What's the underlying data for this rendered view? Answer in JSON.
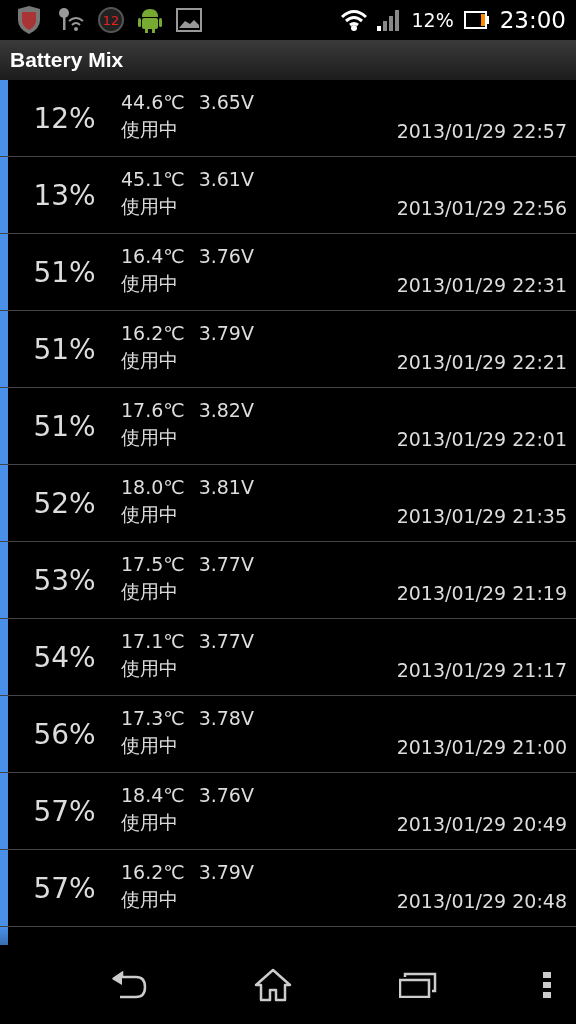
{
  "status_bar": {
    "notification_badge": "12",
    "battery_percent": "12%",
    "time": "23:00"
  },
  "app_bar": {
    "title": "Battery Mix"
  },
  "records": [
    {
      "percent": "12%",
      "temperature": "44.6℃",
      "voltage": "3.65V",
      "state": "使用中",
      "timestamp": "2013/01/29 22:57"
    },
    {
      "percent": "13%",
      "temperature": "45.1℃",
      "voltage": "3.61V",
      "state": "使用中",
      "timestamp": "2013/01/29 22:56"
    },
    {
      "percent": "51%",
      "temperature": "16.4℃",
      "voltage": "3.76V",
      "state": "使用中",
      "timestamp": "2013/01/29 22:31"
    },
    {
      "percent": "51%",
      "temperature": "16.2℃",
      "voltage": "3.79V",
      "state": "使用中",
      "timestamp": "2013/01/29 22:21"
    },
    {
      "percent": "51%",
      "temperature": "17.6℃",
      "voltage": "3.82V",
      "state": "使用中",
      "timestamp": "2013/01/29 22:01"
    },
    {
      "percent": "52%",
      "temperature": "18.0℃",
      "voltage": "3.81V",
      "state": "使用中",
      "timestamp": "2013/01/29 21:35"
    },
    {
      "percent": "53%",
      "temperature": "17.5℃",
      "voltage": "3.77V",
      "state": "使用中",
      "timestamp": "2013/01/29 21:19"
    },
    {
      "percent": "54%",
      "temperature": "17.1℃",
      "voltage": "3.77V",
      "state": "使用中",
      "timestamp": "2013/01/29 21:17"
    },
    {
      "percent": "56%",
      "temperature": "17.3℃",
      "voltage": "3.78V",
      "state": "使用中",
      "timestamp": "2013/01/29 21:00"
    },
    {
      "percent": "57%",
      "temperature": "18.4℃",
      "voltage": "3.76V",
      "state": "使用中",
      "timestamp": "2013/01/29 20:49"
    },
    {
      "percent": "57%",
      "temperature": "16.2℃",
      "voltage": "3.79V",
      "state": "使用中",
      "timestamp": "2013/01/29 20:48"
    }
  ]
}
